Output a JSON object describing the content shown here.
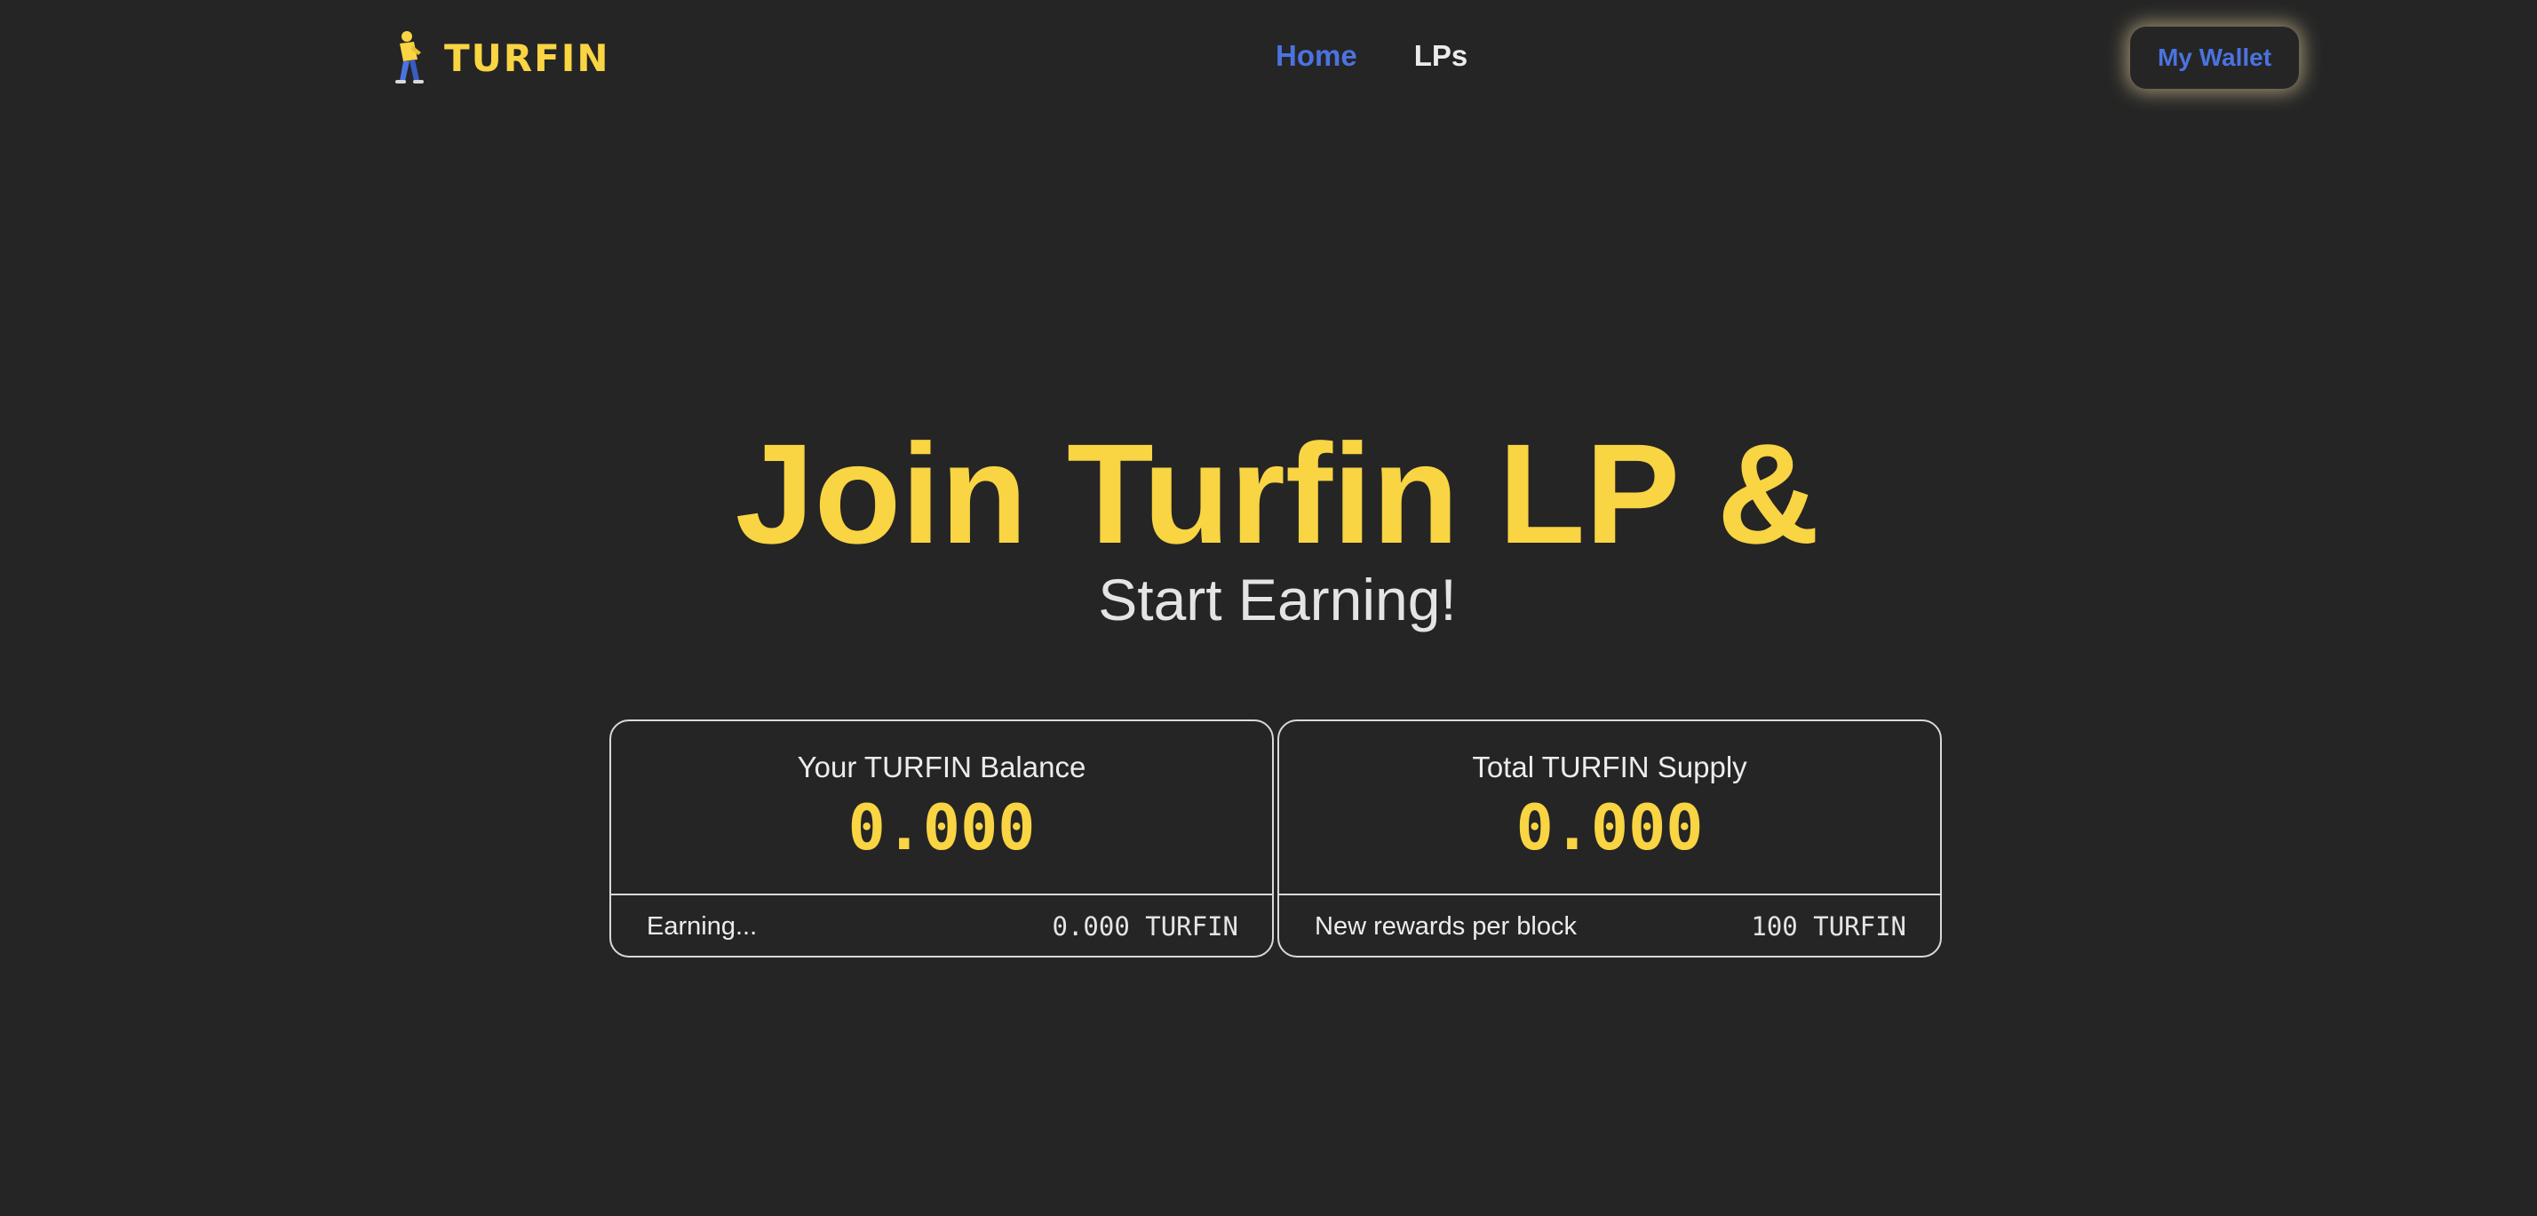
{
  "header": {
    "brand": "TURFIN",
    "brand_icon": "turfin-mascot-icon",
    "nav": [
      {
        "label": "Home",
        "active": true
      },
      {
        "label": "LPs",
        "active": false
      }
    ],
    "wallet_label": "My Wallet"
  },
  "hero": {
    "title": "Join Turfin LP &",
    "subtitle": "Start Earning!"
  },
  "cards": [
    {
      "label": "Your TURFIN Balance",
      "value": "0.000",
      "footer_label": "Earning...",
      "footer_value": "0.000 TURFIN"
    },
    {
      "label": "Total TURFIN Supply",
      "value": "0.000",
      "footer_label": "New rewards per block",
      "footer_value": "100 TURFIN"
    }
  ],
  "colors": {
    "background": "#252525",
    "accent_yellow": "#f9d443",
    "link_blue": "#4b73e0",
    "text_light": "#ececec",
    "border": "#d9d9d9"
  }
}
